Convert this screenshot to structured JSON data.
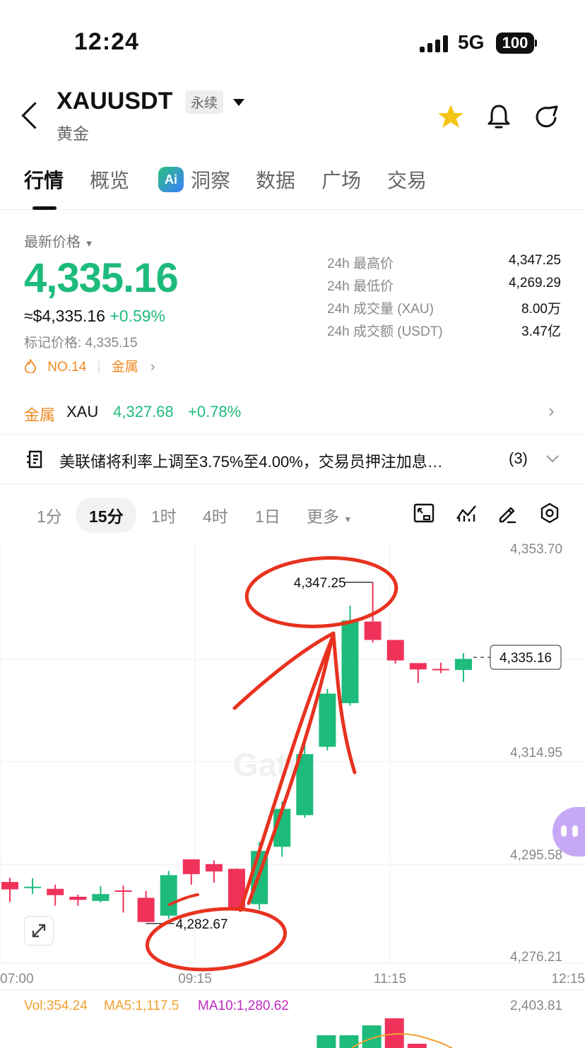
{
  "status_bar": {
    "time": "12:24",
    "network": "5G",
    "battery": "100"
  },
  "header": {
    "symbol": "XAUUSDT",
    "type_badge": "永续",
    "name": "黄金"
  },
  "tabs": [
    {
      "label": "行情",
      "active": true
    },
    {
      "label": "概览"
    },
    {
      "label": "洞察"
    },
    {
      "label": "数据"
    },
    {
      "label": "广场"
    },
    {
      "label": "交易"
    }
  ],
  "ai_badge": "Ai",
  "ticker": {
    "latest_label": "最新价格",
    "price": "4,335.16",
    "usd_price": "≈$4,335.16",
    "change": "+0.59%",
    "mark_price": "标记价格: 4,335.15",
    "rank": "NO.14",
    "category": "金属"
  },
  "stats": [
    {
      "label": "24h 最高价",
      "value": "4,347.25"
    },
    {
      "label": "24h 最低价",
      "value": "4,269.29"
    },
    {
      "label": "24h 成交量 (XAU)",
      "value": "8.00万"
    },
    {
      "label": "24h 成交额 (USDT)",
      "value": "3.47亿"
    }
  ],
  "metal": {
    "category": "金属",
    "symbol": "XAU",
    "price": "4,327.68",
    "change": "+0.78%"
  },
  "news": {
    "text": "美联储将利率上调至3.75%至4.00%，交易员押注加息…",
    "count": "(3)"
  },
  "timeframes": [
    "1分",
    "15分",
    "1时",
    "4时",
    "1日",
    "更多"
  ],
  "active_timeframe": "15分",
  "colors": {
    "up": "#1dbb7c",
    "down": "#f0325a",
    "accent": "#f08a24",
    "annotation": "#e8321f",
    "ma5": "#f0a030",
    "ma10": "#c02ac0"
  },
  "chart_data": {
    "type": "candlestick",
    "x_ticks": [
      "07:00",
      "09:15",
      "11:15",
      "12:15"
    ],
    "y_ticks": [
      "4,353.70",
      "4,314.95",
      "4,295.58",
      "4,276.21"
    ],
    "ylim": [
      4276.21,
      4353.7
    ],
    "high_label": "4,347.25",
    "low_label": "4,282.67",
    "current_price": "4,335.16",
    "watermark": "Gate",
    "candles": [
      {
        "o": 4290.3,
        "c": 4288.9,
        "h": 4291.1,
        "l": 4286.5
      },
      {
        "o": 4289.2,
        "c": 4289.4,
        "h": 4291.0,
        "l": 4288.0
      },
      {
        "o": 4289.0,
        "c": 4287.8,
        "h": 4289.8,
        "l": 4285.8
      },
      {
        "o": 4287.5,
        "c": 4286.9,
        "h": 4287.9,
        "l": 4285.8
      },
      {
        "o": 4286.7,
        "c": 4288.0,
        "h": 4289.5,
        "l": 4286.4
      },
      {
        "o": 4288.7,
        "c": 4288.6,
        "h": 4289.6,
        "l": 4284.5
      },
      {
        "o": 4287.3,
        "c": 4282.7,
        "h": 4288.6,
        "l": 4282.67
      },
      {
        "o": 4283.9,
        "c": 4291.6,
        "h": 4292.4,
        "l": 4283.3
      },
      {
        "o": 4294.6,
        "c": 4291.8,
        "h": 4294.6,
        "l": 4289.8
      },
      {
        "o": 4293.7,
        "c": 4292.3,
        "h": 4294.4,
        "l": 4290.2
      },
      {
        "o": 4292.8,
        "c": 4285.1,
        "h": 4292.9,
        "l": 4284.8
      },
      {
        "o": 4286.1,
        "c": 4296.2,
        "h": 4297.9,
        "l": 4285.0
      },
      {
        "o": 4297.0,
        "c": 4304.2,
        "h": 4305.6,
        "l": 4295.1
      },
      {
        "o": 4303.0,
        "c": 4314.6,
        "h": 4317.0,
        "l": 4302.5
      },
      {
        "o": 4316.0,
        "c": 4326.1,
        "h": 4327.0,
        "l": 4315.3
      },
      {
        "o": 4324.3,
        "c": 4340.0,
        "h": 4342.8,
        "l": 4323.8
      },
      {
        "o": 4339.8,
        "c": 4336.3,
        "h": 4347.25,
        "l": 4335.8
      },
      {
        "o": 4336.3,
        "c": 4332.4,
        "h": 4336.3,
        "l": 4331.8
      },
      {
        "o": 4331.9,
        "c": 4330.7,
        "h": 4331.9,
        "l": 4328.1
      },
      {
        "o": 4330.8,
        "c": 4330.6,
        "h": 4332.0,
        "l": 4330.0
      },
      {
        "o": 4330.6,
        "c": 4332.7,
        "h": 4333.8,
        "l": 4328.3
      }
    ],
    "volume_label": "Vol:354.24",
    "ma5_label": "MA5:1,117.5",
    "ma10_label": "MA10:1,280.62",
    "volume_axis": "2,403.81"
  }
}
